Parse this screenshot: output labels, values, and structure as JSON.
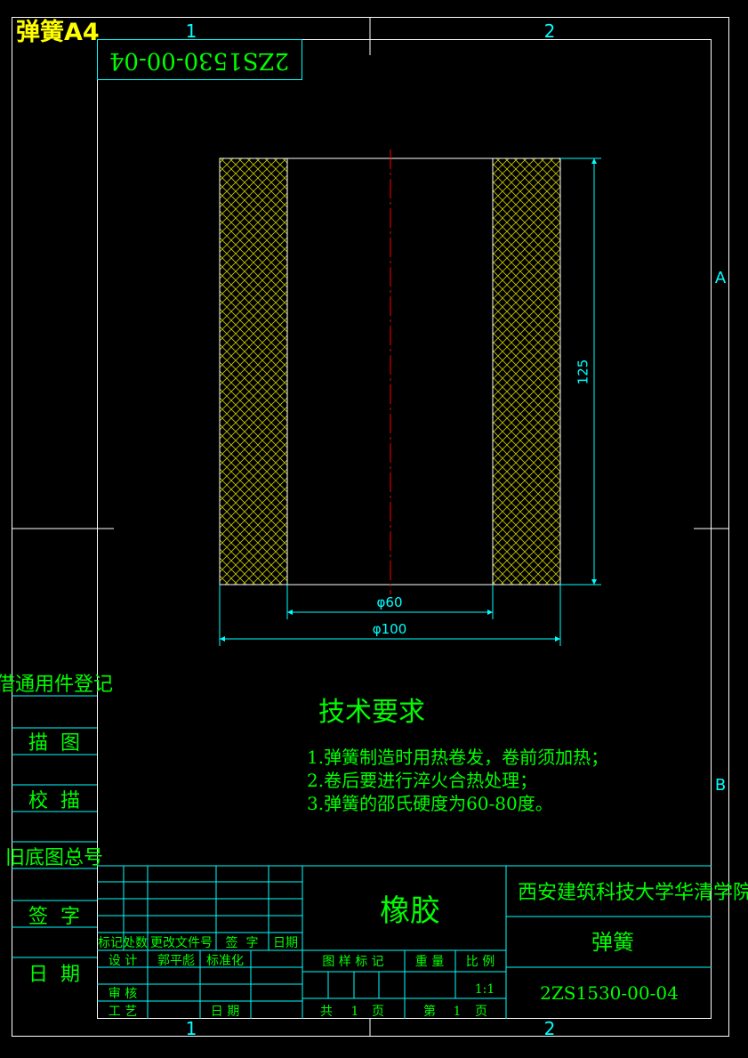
{
  "colors": {
    "background": "#000000",
    "frame": "#ffffff",
    "green": "#00ff00",
    "cyan": "#00ffff",
    "yellow": "#ffff00",
    "red": "#ff0000",
    "hatch": "#ffff00"
  },
  "sheet": {
    "label": "弹簧A4",
    "code_rotated": "2ZS1530-00-04",
    "zone_top_1": "1",
    "zone_top_2": "2",
    "zone_bottom_1": "1",
    "zone_bottom_2": "2",
    "zone_right_a": "A",
    "zone_right_b": "B"
  },
  "drawing": {
    "dim_height": "125",
    "dim_inner": "φ60",
    "dim_outer": "φ100"
  },
  "requirements": {
    "title": "技术要求",
    "items": [
      "1.弹簧制造时用热卷发，卷前须加热；",
      "2.卷后要进行淬火合热处理；",
      "3.弹簧的邵氏硬度为60-80度。"
    ]
  },
  "side_panel": {
    "register": "借通用件登记",
    "draw": "描  图",
    "check_trace": "校  描",
    "old_number": "旧底图总号",
    "sign": "签  字",
    "date": "日  期"
  },
  "title_block": {
    "material": "橡胶",
    "school": "西安建筑科技大学华清学院",
    "part_name": "弹簧",
    "drawing_number": "2ZS1530-00-04",
    "h_mark": "标记",
    "h_count": "处数",
    "h_doc": "更改文件号",
    "h_sign": "签  字",
    "h_date": "日期",
    "design": "设 计",
    "designer": "郭平彪",
    "standard": "标准化",
    "review": "审 核",
    "process": "工 艺",
    "date2": "日 期",
    "pattern_mark": "图 样 标 记",
    "weight": "重 量",
    "scale": "比 例",
    "scale_value": "1:1",
    "total_label": "共",
    "total_value": "1",
    "page_unit": "页",
    "sheet_label": "第",
    "sheet_value": "1",
    "sheet_unit": "页"
  }
}
